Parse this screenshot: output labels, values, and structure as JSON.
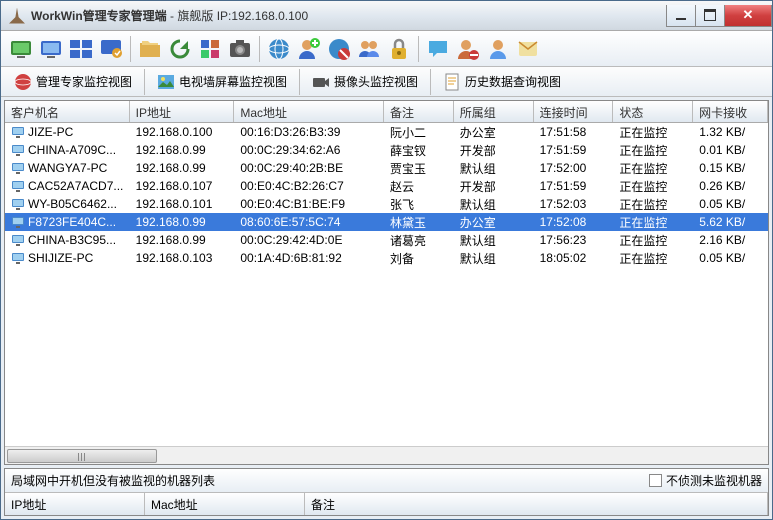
{
  "window": {
    "app_name": "WorkWin管理专家管理端",
    "edition": "旗舰版",
    "ip_label": "IP:",
    "ip": "192.168.0.100"
  },
  "tabs": [
    {
      "label": "管理专家监控视图"
    },
    {
      "label": "电视墙屏幕监控视图"
    },
    {
      "label": "摄像头监控视图"
    },
    {
      "label": "历史数据查询视图"
    }
  ],
  "columns": [
    "客户机名",
    "IP地址",
    "Mac地址",
    "备注",
    "所属组",
    "连接时间",
    "状态",
    "网卡接收"
  ],
  "rows": [
    {
      "name": "JIZE-PC",
      "ip": "192.168.0.100",
      "mac": "00:16:D3:26:B3:39",
      "note": "阮小二",
      "group": "办公室",
      "time": "17:51:58",
      "status": "正在监控",
      "nic": "1.32 KB/"
    },
    {
      "name": "CHINA-A709C...",
      "ip": "192.168.0.99",
      "mac": "00:0C:29:34:62:A6",
      "note": "薛宝钗",
      "group": "开发部",
      "time": "17:51:59",
      "status": "正在监控",
      "nic": "0.01 KB/"
    },
    {
      "name": "WANGYA7-PC",
      "ip": "192.168.0.99",
      "mac": "00:0C:29:40:2B:BE",
      "note": "贾宝玉",
      "group": "默认组",
      "time": "17:52:00",
      "status": "正在监控",
      "nic": "0.15 KB/"
    },
    {
      "name": "CAC52A7ACD7...",
      "ip": "192.168.0.107",
      "mac": "00:E0:4C:B2:26:C7",
      "note": "赵云",
      "group": "开发部",
      "time": "17:51:59",
      "status": "正在监控",
      "nic": "0.26 KB/"
    },
    {
      "name": "WY-B05C6462...",
      "ip": "192.168.0.101",
      "mac": "00:E0:4C:B1:BE:F9",
      "note": "张飞",
      "group": "默认组",
      "time": "17:52:03",
      "status": "正在监控",
      "nic": "0.05 KB/"
    },
    {
      "name": "F8723FE404C...",
      "ip": "192.168.0.99",
      "mac": "08:60:6E:57:5C:74",
      "note": "林黛玉",
      "group": "办公室",
      "time": "17:52:08",
      "status": "正在监控",
      "nic": "5.62 KB/",
      "selected": true
    },
    {
      "name": "CHINA-B3C95...",
      "ip": "192.168.0.99",
      "mac": "00:0C:29:42:4D:0E",
      "note": "诸葛亮",
      "group": "默认组",
      "time": "17:56:23",
      "status": "正在监控",
      "nic": "2.16 KB/"
    },
    {
      "name": "SHIJIZE-PC",
      "ip": "192.168.0.103",
      "mac": "00:1A:4D:6B:81:92",
      "note": "刘备",
      "group": "默认组",
      "time": "18:05:02",
      "status": "正在监控",
      "nic": "0.05 KB/"
    }
  ],
  "bottom": {
    "title": "局域网中开机但没有被监视的机器列表",
    "checkbox_label": "不侦测未监视机器",
    "columns": [
      "IP地址",
      "Mac地址",
      "备注"
    ]
  },
  "toolbar_icons": [
    "monitor-all-icon",
    "screen-icon",
    "multi-monitor-icon",
    "monitor-list-icon",
    "folders-icon",
    "refresh-icon",
    "bulk-icon",
    "screenshot-icon",
    "globe-icon",
    "add-user-icon",
    "web-block-icon",
    "user-group-icon",
    "lock-icon",
    "chat-icon",
    "user-block-icon",
    "user-info-icon",
    "notify-icon"
  ]
}
